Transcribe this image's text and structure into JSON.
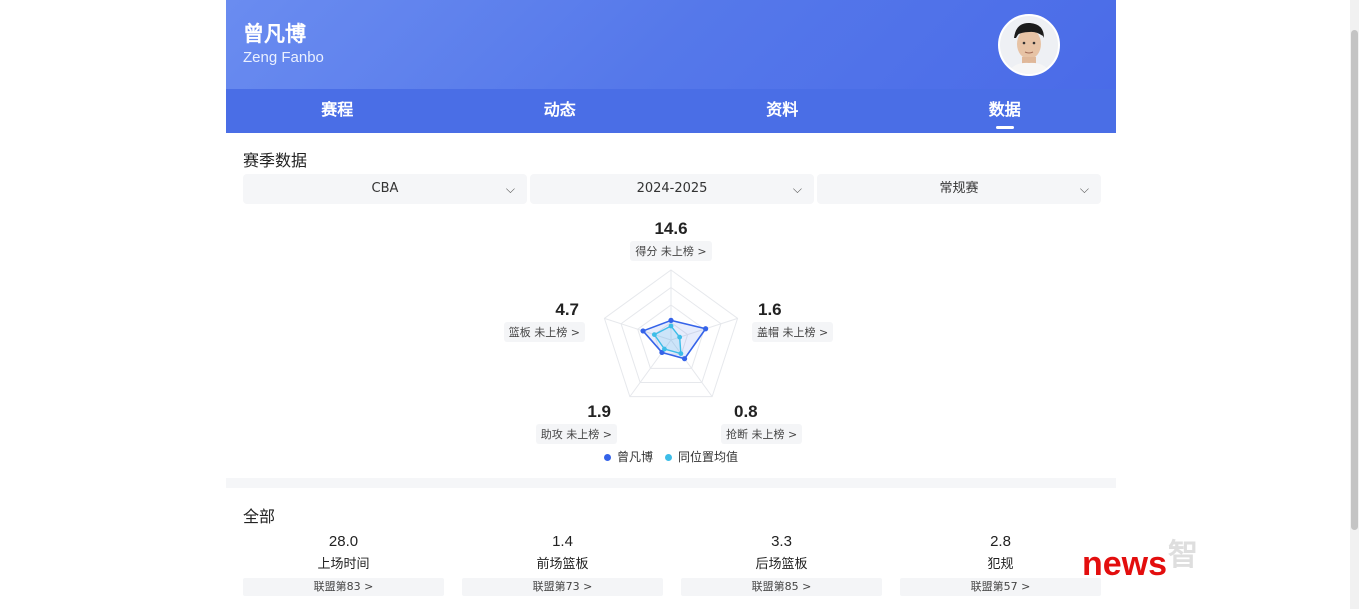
{
  "player": {
    "name_cn": "曾凡博",
    "name_en": "Zeng Fanbo"
  },
  "tabs": [
    {
      "label": "赛程",
      "active": false
    },
    {
      "label": "动态",
      "active": false
    },
    {
      "label": "资料",
      "active": false
    },
    {
      "label": "数据",
      "active": true
    }
  ],
  "season_section": {
    "title": "赛季数据",
    "filters": [
      {
        "value": "CBA"
      },
      {
        "value": "2024-2025"
      },
      {
        "value": "常规赛"
      }
    ]
  },
  "radar": {
    "stats": [
      {
        "key": "points",
        "value": "14.6",
        "label": "得分 未上榜 >",
        "player_norm": 0.28,
        "avg_norm": 0.2
      },
      {
        "key": "blocks",
        "value": "1.6",
        "label": "盖帽 未上榜 >",
        "player_norm": 0.52,
        "avg_norm": 0.13
      },
      {
        "key": "steals",
        "value": "0.8",
        "label": "抢断 未上榜 >",
        "player_norm": 0.33,
        "avg_norm": 0.24
      },
      {
        "key": "assists",
        "value": "1.9",
        "label": "助攻 未上榜 >",
        "player_norm": 0.22,
        "avg_norm": 0.16
      },
      {
        "key": "rebounds",
        "value": "4.7",
        "label": "篮板 未上榜 >",
        "player_norm": 0.42,
        "avg_norm": 0.25
      }
    ],
    "legend": [
      {
        "label": "曾凡博",
        "color": "#3563e9"
      },
      {
        "label": "同位置均值",
        "color": "#3dbde8"
      }
    ]
  },
  "summary_section": {
    "title": "全部",
    "items": [
      {
        "value": "28.0",
        "label": "上场时间",
        "rank": "联盟第83 >"
      },
      {
        "value": "1.4",
        "label": "前场篮板",
        "rank": "联盟第73 >"
      },
      {
        "value": "3.3",
        "label": "后场篮板",
        "rank": "联盟第85 >"
      },
      {
        "value": "2.8",
        "label": "犯规",
        "rank": "联盟第57 >"
      }
    ]
  },
  "watermark": {
    "text": "智",
    "brand": "news"
  }
}
